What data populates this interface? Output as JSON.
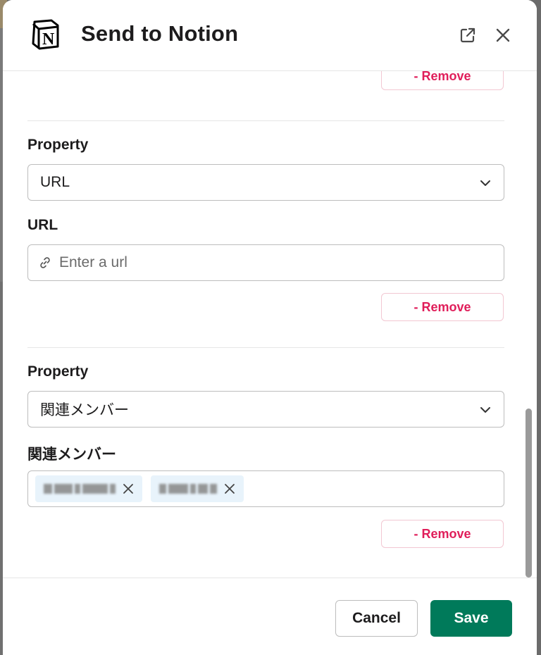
{
  "header": {
    "title": "Send to Notion",
    "logo_icon": "notion-logo",
    "actions": [
      "external-link-icon",
      "close-icon"
    ]
  },
  "sections": [
    {
      "remove_label": "- Remove"
    },
    {
      "property_label": "Property",
      "property_value": "URL",
      "field_label": "URL",
      "field_placeholder": "Enter a url",
      "remove_label": "- Remove"
    },
    {
      "property_label": "Property",
      "property_value": "関連メンバー",
      "field_label": "関連メンバー",
      "remove_label": "- Remove"
    }
  ],
  "footer": {
    "cancel_label": "Cancel",
    "save_label": "Save"
  },
  "colors": {
    "accent": "#007a5a",
    "danger": "#e01e5a",
    "chip_bg": "#e8f3fb"
  }
}
